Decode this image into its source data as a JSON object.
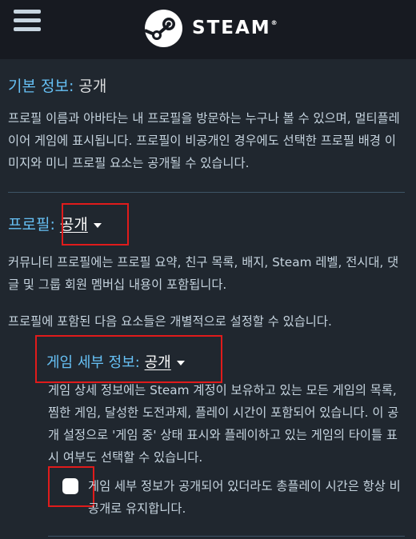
{
  "header": {
    "logo_text": "STEAM",
    "trademark": "®"
  },
  "basic_info": {
    "label": "기본 정보:",
    "value": "공개",
    "description": "프로필 이름과 아바타는 내 프로필을 방문하는 누구나 볼 수 있으며, 멀티플레이어 게임에 표시됩니다. 프로필이 비공개인 경우에도 선택한 프로필 배경 이미지와 미니 프로필 요소는 공개될 수 있습니다."
  },
  "profile": {
    "label": "프로필:",
    "value": "공개",
    "description": "커뮤니티 프로필에는 프로필 요약, 친구 목록, 배지, Steam 레벨, 전시대, 댓글 및 그룹 회원 멤버십 내용이 포함됩니다.",
    "note": "프로필에 포함된 다음 요소들은 개별적으로 설정할 수 있습니다."
  },
  "game_details": {
    "label": "게임 세부 정보:",
    "value": "공개",
    "description": "게임 상세 정보에는 Steam 계정이 보유하고 있는 모든 게임의 목록, 찜한 게임, 달성한 도전과제, 플레이 시간이 포함되어 있습니다. 이 공개 설정으로 '게임 중' 상태 표시와 플레이하고 있는 게임의 타이틀 표시 여부도 선택할 수 있습니다.",
    "checkbox_label": "게임 세부 정보가 공개되어 있더라도 총플레이 시간은 항상 비공개로 유지합니다.",
    "checkbox_checked": false
  }
}
